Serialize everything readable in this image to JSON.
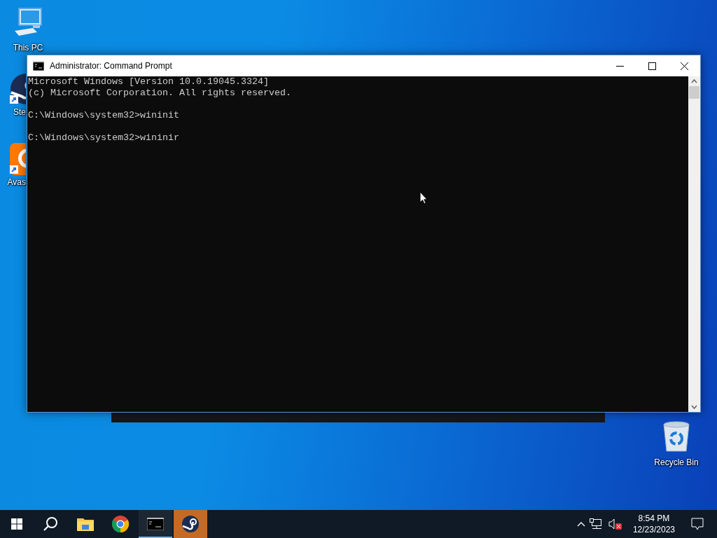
{
  "desktop_icons": [
    {
      "label": "This PC",
      "kind": "pc"
    },
    {
      "label": "Ste",
      "kind": "steam"
    },
    {
      "label": "Avas",
      "kind": "avast"
    },
    {
      "label": "Recycle Bin",
      "kind": "recycle"
    }
  ],
  "window": {
    "title": "Administrator: Command Prompt",
    "console": [
      [
        "Microsoft Windows [Version 10.0.19045.3324]",
        "(c) Microsoft Corporation. All rights reserved."
      ],
      [
        "C:\\Windows\\system32>wininit"
      ],
      [
        "C:\\Windows\\system32>wininir"
      ]
    ]
  },
  "taskbar": {
    "apps": [
      {
        "kind": "explorer",
        "running": false,
        "flashing": false
      },
      {
        "kind": "chrome",
        "running": false,
        "flashing": false
      },
      {
        "kind": "cmd",
        "running": true,
        "flashing": false
      },
      {
        "kind": "steam",
        "running": false,
        "flashing": true
      }
    ],
    "tray": {
      "volume_muted": true
    },
    "clock": {
      "time": "8:54 PM",
      "date": "12/23/2023"
    }
  }
}
